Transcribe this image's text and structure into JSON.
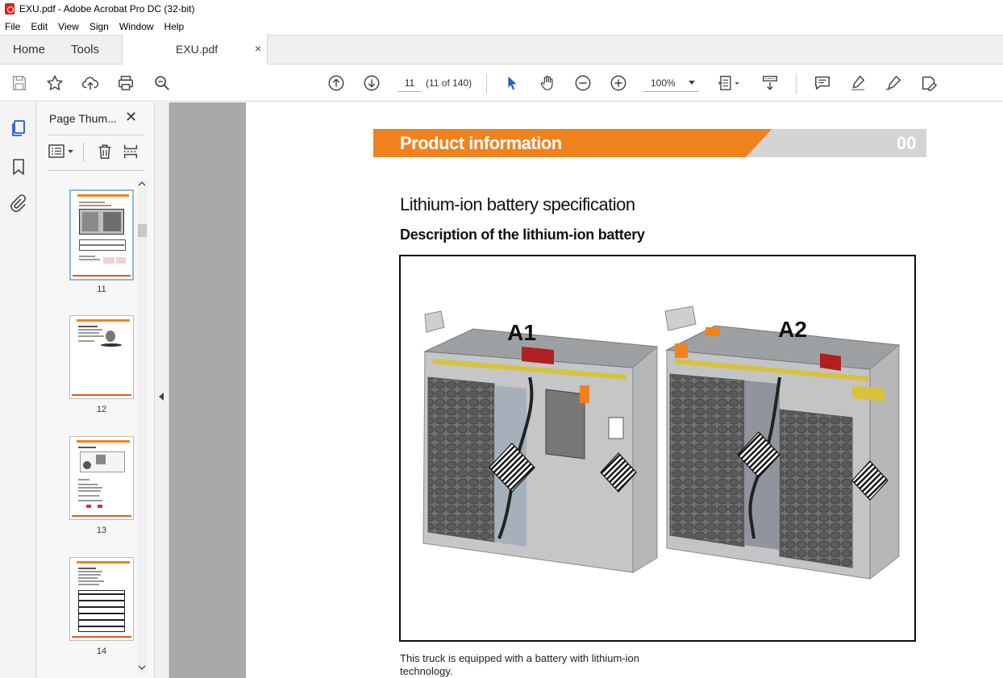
{
  "window": {
    "title": "EXU.pdf - Adobe Acrobat Pro DC (32-bit)"
  },
  "menu": [
    "File",
    "Edit",
    "View",
    "Sign",
    "Window",
    "Help"
  ],
  "tabs": {
    "home": "Home",
    "tools": "Tools",
    "document": "EXU.pdf",
    "close": "×"
  },
  "toolbar": {
    "page_input": "11",
    "page_count": "(11 of 140)",
    "zoom": "100%"
  },
  "thumbnail_panel": {
    "title": "Page Thum...",
    "close": "✕",
    "pages": [
      "11",
      "12",
      "13",
      "14"
    ]
  },
  "document": {
    "header_title": "Product information",
    "header_number": "00",
    "heading": "Lithium-ion battery specification",
    "subheading": "Description of the lithium-ion battery",
    "figure_labels": {
      "a1": "A1",
      "a2": "A2"
    },
    "caption": "This truck is equipped with a battery with lithium-ion technology."
  },
  "colors": {
    "accent_orange": "#f0821e",
    "header_gray": "#d4d4d4",
    "selection_blue": "#8fb3dd",
    "cursor_blue": "#1f5fc7"
  }
}
